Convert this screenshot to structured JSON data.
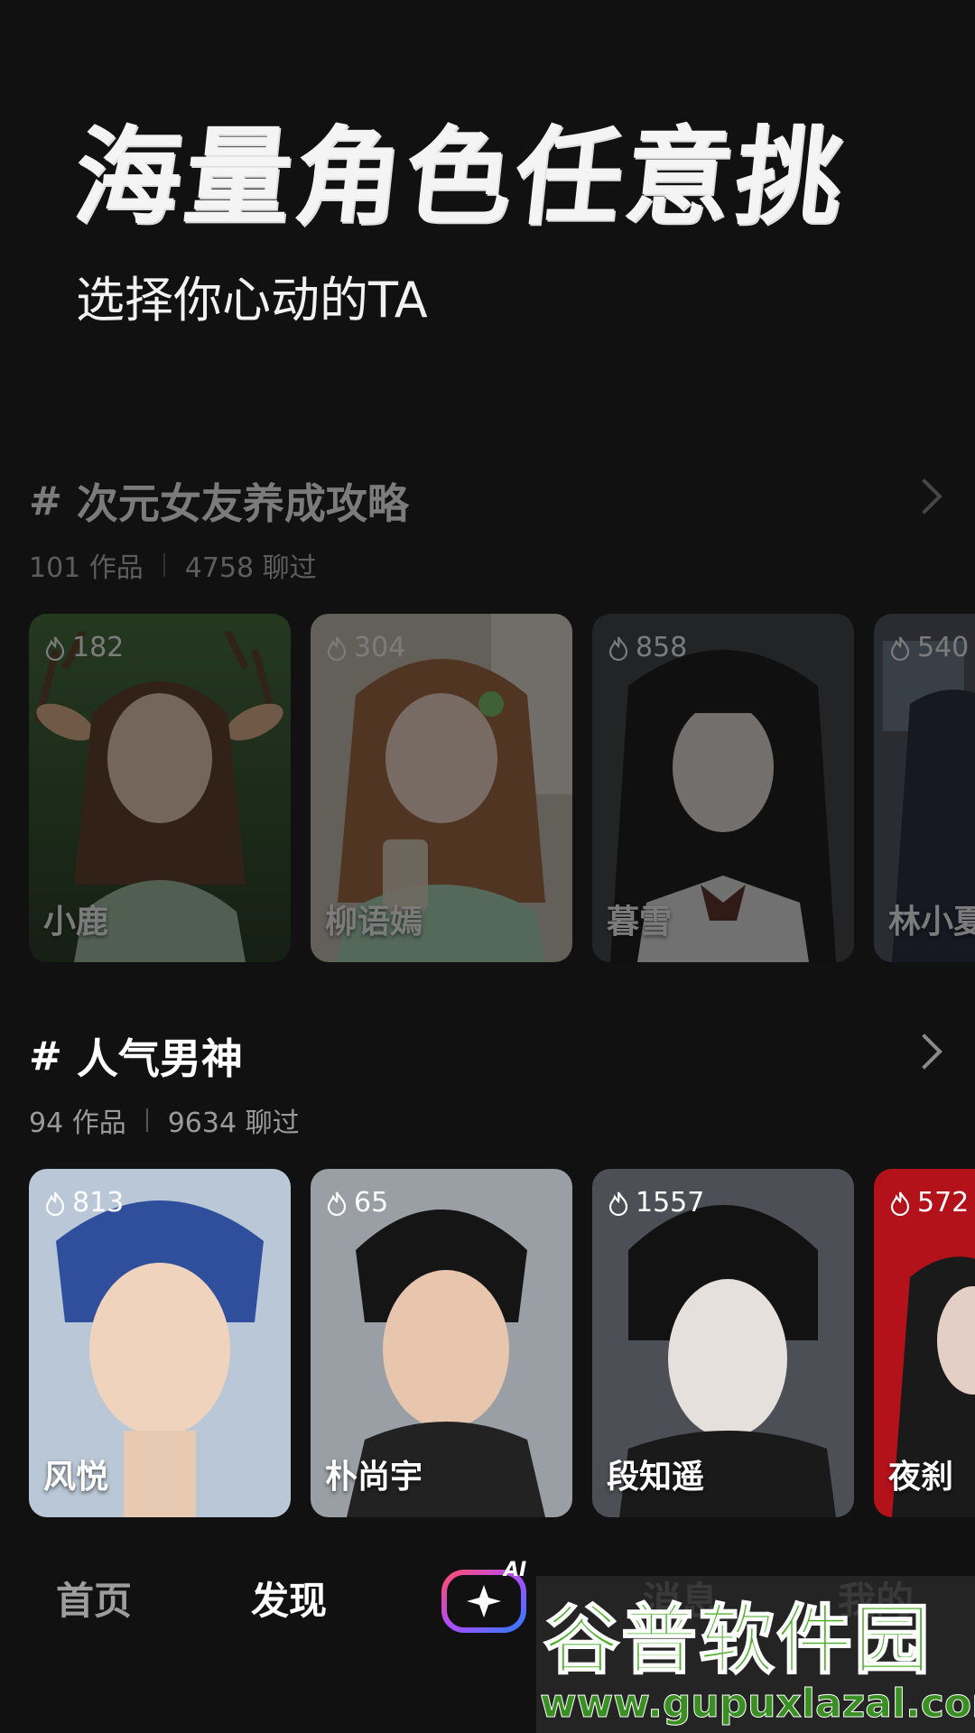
{
  "hero": {
    "title": "海量角色任意挑",
    "subtitle": "选择你心动的TA"
  },
  "sections": [
    {
      "hash": "#",
      "title": "次元女友养成攻略",
      "works": "101 作品",
      "chats": "4758 聊过",
      "cards": [
        {
          "heat": "182",
          "name": "小鹿"
        },
        {
          "heat": "304",
          "name": "柳语嫣"
        },
        {
          "heat": "858",
          "name": "暮雪"
        },
        {
          "heat": "540",
          "name": "林小夏"
        }
      ]
    },
    {
      "hash": "#",
      "title": "人气男神",
      "works": "94 作品",
      "chats": "9634 聊过",
      "cards": [
        {
          "heat": "813",
          "name": "风悦"
        },
        {
          "heat": "65",
          "name": "朴尚宇"
        },
        {
          "heat": "1557",
          "name": "段知遥"
        },
        {
          "heat": "572",
          "name": "夜刹"
        }
      ]
    }
  ],
  "tabbar": {
    "home": "首页",
    "discover": "发现",
    "ai_label": "AI",
    "messages": "消息",
    "mine": "我的"
  },
  "watermark": {
    "main": "谷普软件园",
    "url": "www.gupuxlazal.com"
  },
  "colors": {
    "background": "#111111",
    "active_tab": "#ffffff",
    "inactive_tab": "#9d9d9d",
    "watermark_green": "#4caf2a"
  }
}
